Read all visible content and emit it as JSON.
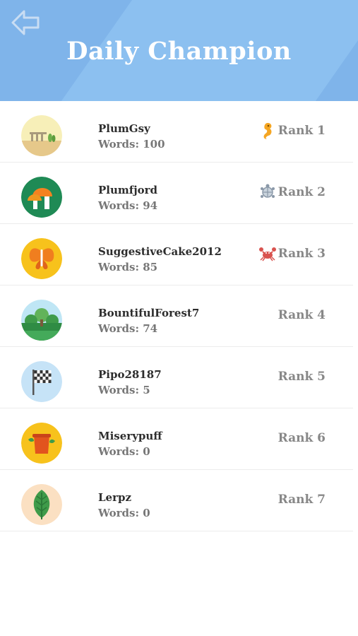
{
  "header": {
    "title": "Daily Champion",
    "back_icon": "back-arrow-icon"
  },
  "colors": {
    "header_bg": "#7fb4ea",
    "gold": "#f5a623",
    "silver": "#8a98a8",
    "bronze": "#d9534f"
  },
  "leaderboard": [
    {
      "name": "PlumGsy",
      "words": "Words: 100",
      "rank": "Rank 1",
      "avatar": "ruins-avatar",
      "medal": "seahorse-icon"
    },
    {
      "name": "Plumfjord",
      "words": "Words: 94",
      "rank": "Rank 2",
      "avatar": "mushroom-avatar",
      "medal": "turtle-icon"
    },
    {
      "name": "SuggestiveCake2012",
      "words": "Words: 85",
      "rank": "Rank 3",
      "avatar": "butterfly-avatar",
      "medal": "crab-icon"
    },
    {
      "name": "BountifulForest7",
      "words": "Words: 74",
      "rank": "Rank 4",
      "avatar": "forest-avatar",
      "medal": ""
    },
    {
      "name": "Pipo28187",
      "words": "Words: 5",
      "rank": "Rank 5",
      "avatar": "flag-avatar",
      "medal": ""
    },
    {
      "name": "Miserypuff",
      "words": "Words: 0",
      "rank": "Rank 6",
      "avatar": "stump-avatar",
      "medal": ""
    },
    {
      "name": "Lerpz",
      "words": "Words: 0",
      "rank": "Rank 7",
      "avatar": "leaf-avatar",
      "medal": ""
    }
  ]
}
